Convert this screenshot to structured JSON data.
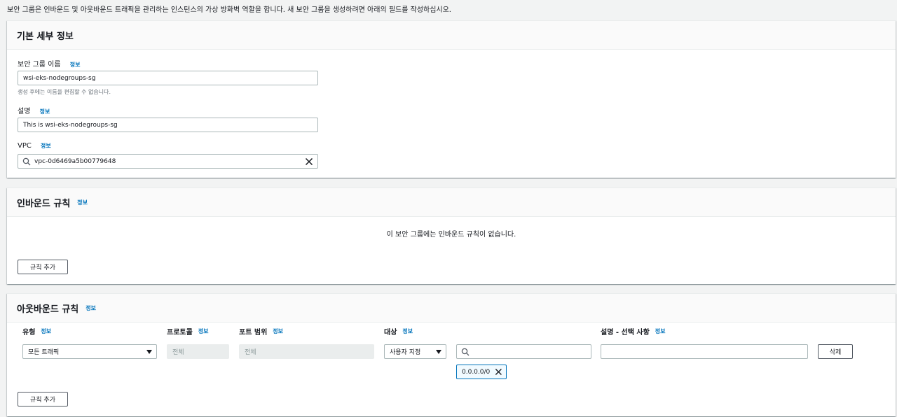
{
  "intro_text": "보안 그룹은 인바운드 및 아웃바운드 트래픽을 관리하는 인스턴스의 가상 방화벽 역할을 합니다. 새 보안 그룹을 생성하려면 아래의 필드를 작성하십시오.",
  "info_label": "정보",
  "basic": {
    "title": "기본 세부 정보",
    "name_label": "보안 그룹 이름",
    "name_value": "wsi-eks-nodegroups-sg",
    "name_hint": "생성 후에는 이름을 편집할 수 없습니다.",
    "desc_label": "설명",
    "desc_value": "This is wsi-eks-nodegroups-sg",
    "vpc_label": "VPC",
    "vpc_value": "vpc-0d6469a5b00779648"
  },
  "inbound": {
    "title": "인바운드 규칙",
    "empty_text": "이 보안 그룹에는 인바운드 규칙이 없습니다.",
    "add_rule_label": "규칙 추가"
  },
  "outbound": {
    "title": "아웃바운드 규칙",
    "columns": {
      "type": "유형",
      "protocol": "프로토콜",
      "port_range": "포트 범위",
      "destination": "대상",
      "description": "설명 - 선택 사항"
    },
    "row": {
      "type_value": "모든 트래픽",
      "protocol_value": "전체",
      "port_value": "전체",
      "destination_mode": "사용자 지정",
      "search_value": "",
      "cidr_token": "0.0.0.0/0",
      "description_value": "",
      "delete_label": "삭제"
    },
    "add_rule_label": "규칙 추가"
  }
}
